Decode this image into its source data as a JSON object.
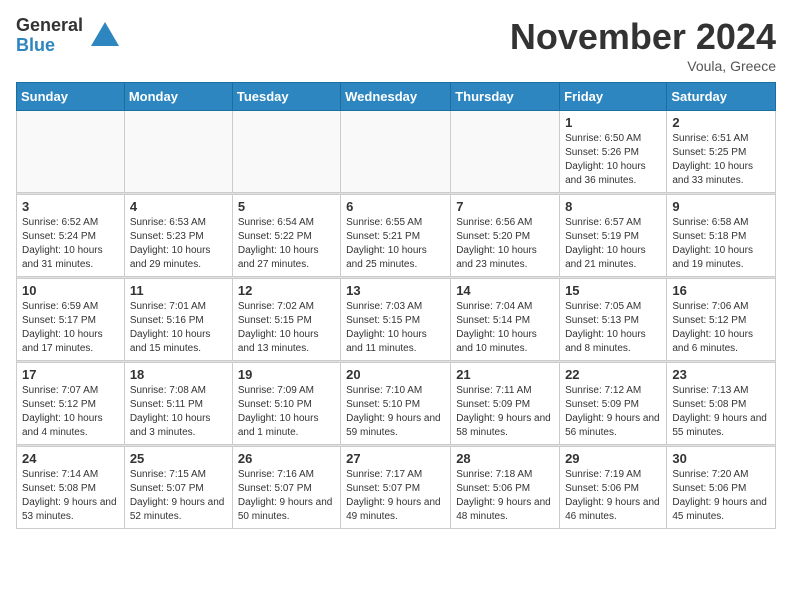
{
  "logo": {
    "general": "General",
    "blue": "Blue"
  },
  "header": {
    "month": "November 2024",
    "location": "Voula, Greece"
  },
  "days_of_week": [
    "Sunday",
    "Monday",
    "Tuesday",
    "Wednesday",
    "Thursday",
    "Friday",
    "Saturday"
  ],
  "weeks": [
    [
      {
        "day": "",
        "info": ""
      },
      {
        "day": "",
        "info": ""
      },
      {
        "day": "",
        "info": ""
      },
      {
        "day": "",
        "info": ""
      },
      {
        "day": "",
        "info": ""
      },
      {
        "day": "1",
        "info": "Sunrise: 6:50 AM\nSunset: 5:26 PM\nDaylight: 10 hours and 36 minutes."
      },
      {
        "day": "2",
        "info": "Sunrise: 6:51 AM\nSunset: 5:25 PM\nDaylight: 10 hours and 33 minutes."
      }
    ],
    [
      {
        "day": "3",
        "info": "Sunrise: 6:52 AM\nSunset: 5:24 PM\nDaylight: 10 hours and 31 minutes."
      },
      {
        "day": "4",
        "info": "Sunrise: 6:53 AM\nSunset: 5:23 PM\nDaylight: 10 hours and 29 minutes."
      },
      {
        "day": "5",
        "info": "Sunrise: 6:54 AM\nSunset: 5:22 PM\nDaylight: 10 hours and 27 minutes."
      },
      {
        "day": "6",
        "info": "Sunrise: 6:55 AM\nSunset: 5:21 PM\nDaylight: 10 hours and 25 minutes."
      },
      {
        "day": "7",
        "info": "Sunrise: 6:56 AM\nSunset: 5:20 PM\nDaylight: 10 hours and 23 minutes."
      },
      {
        "day": "8",
        "info": "Sunrise: 6:57 AM\nSunset: 5:19 PM\nDaylight: 10 hours and 21 minutes."
      },
      {
        "day": "9",
        "info": "Sunrise: 6:58 AM\nSunset: 5:18 PM\nDaylight: 10 hours and 19 minutes."
      }
    ],
    [
      {
        "day": "10",
        "info": "Sunrise: 6:59 AM\nSunset: 5:17 PM\nDaylight: 10 hours and 17 minutes."
      },
      {
        "day": "11",
        "info": "Sunrise: 7:01 AM\nSunset: 5:16 PM\nDaylight: 10 hours and 15 minutes."
      },
      {
        "day": "12",
        "info": "Sunrise: 7:02 AM\nSunset: 5:15 PM\nDaylight: 10 hours and 13 minutes."
      },
      {
        "day": "13",
        "info": "Sunrise: 7:03 AM\nSunset: 5:15 PM\nDaylight: 10 hours and 11 minutes."
      },
      {
        "day": "14",
        "info": "Sunrise: 7:04 AM\nSunset: 5:14 PM\nDaylight: 10 hours and 10 minutes."
      },
      {
        "day": "15",
        "info": "Sunrise: 7:05 AM\nSunset: 5:13 PM\nDaylight: 10 hours and 8 minutes."
      },
      {
        "day": "16",
        "info": "Sunrise: 7:06 AM\nSunset: 5:12 PM\nDaylight: 10 hours and 6 minutes."
      }
    ],
    [
      {
        "day": "17",
        "info": "Sunrise: 7:07 AM\nSunset: 5:12 PM\nDaylight: 10 hours and 4 minutes."
      },
      {
        "day": "18",
        "info": "Sunrise: 7:08 AM\nSunset: 5:11 PM\nDaylight: 10 hours and 3 minutes."
      },
      {
        "day": "19",
        "info": "Sunrise: 7:09 AM\nSunset: 5:10 PM\nDaylight: 10 hours and 1 minute."
      },
      {
        "day": "20",
        "info": "Sunrise: 7:10 AM\nSunset: 5:10 PM\nDaylight: 9 hours and 59 minutes."
      },
      {
        "day": "21",
        "info": "Sunrise: 7:11 AM\nSunset: 5:09 PM\nDaylight: 9 hours and 58 minutes."
      },
      {
        "day": "22",
        "info": "Sunrise: 7:12 AM\nSunset: 5:09 PM\nDaylight: 9 hours and 56 minutes."
      },
      {
        "day": "23",
        "info": "Sunrise: 7:13 AM\nSunset: 5:08 PM\nDaylight: 9 hours and 55 minutes."
      }
    ],
    [
      {
        "day": "24",
        "info": "Sunrise: 7:14 AM\nSunset: 5:08 PM\nDaylight: 9 hours and 53 minutes."
      },
      {
        "day": "25",
        "info": "Sunrise: 7:15 AM\nSunset: 5:07 PM\nDaylight: 9 hours and 52 minutes."
      },
      {
        "day": "26",
        "info": "Sunrise: 7:16 AM\nSunset: 5:07 PM\nDaylight: 9 hours and 50 minutes."
      },
      {
        "day": "27",
        "info": "Sunrise: 7:17 AM\nSunset: 5:07 PM\nDaylight: 9 hours and 49 minutes."
      },
      {
        "day": "28",
        "info": "Sunrise: 7:18 AM\nSunset: 5:06 PM\nDaylight: 9 hours and 48 minutes."
      },
      {
        "day": "29",
        "info": "Sunrise: 7:19 AM\nSunset: 5:06 PM\nDaylight: 9 hours and 46 minutes."
      },
      {
        "day": "30",
        "info": "Sunrise: 7:20 AM\nSunset: 5:06 PM\nDaylight: 9 hours and 45 minutes."
      }
    ]
  ]
}
